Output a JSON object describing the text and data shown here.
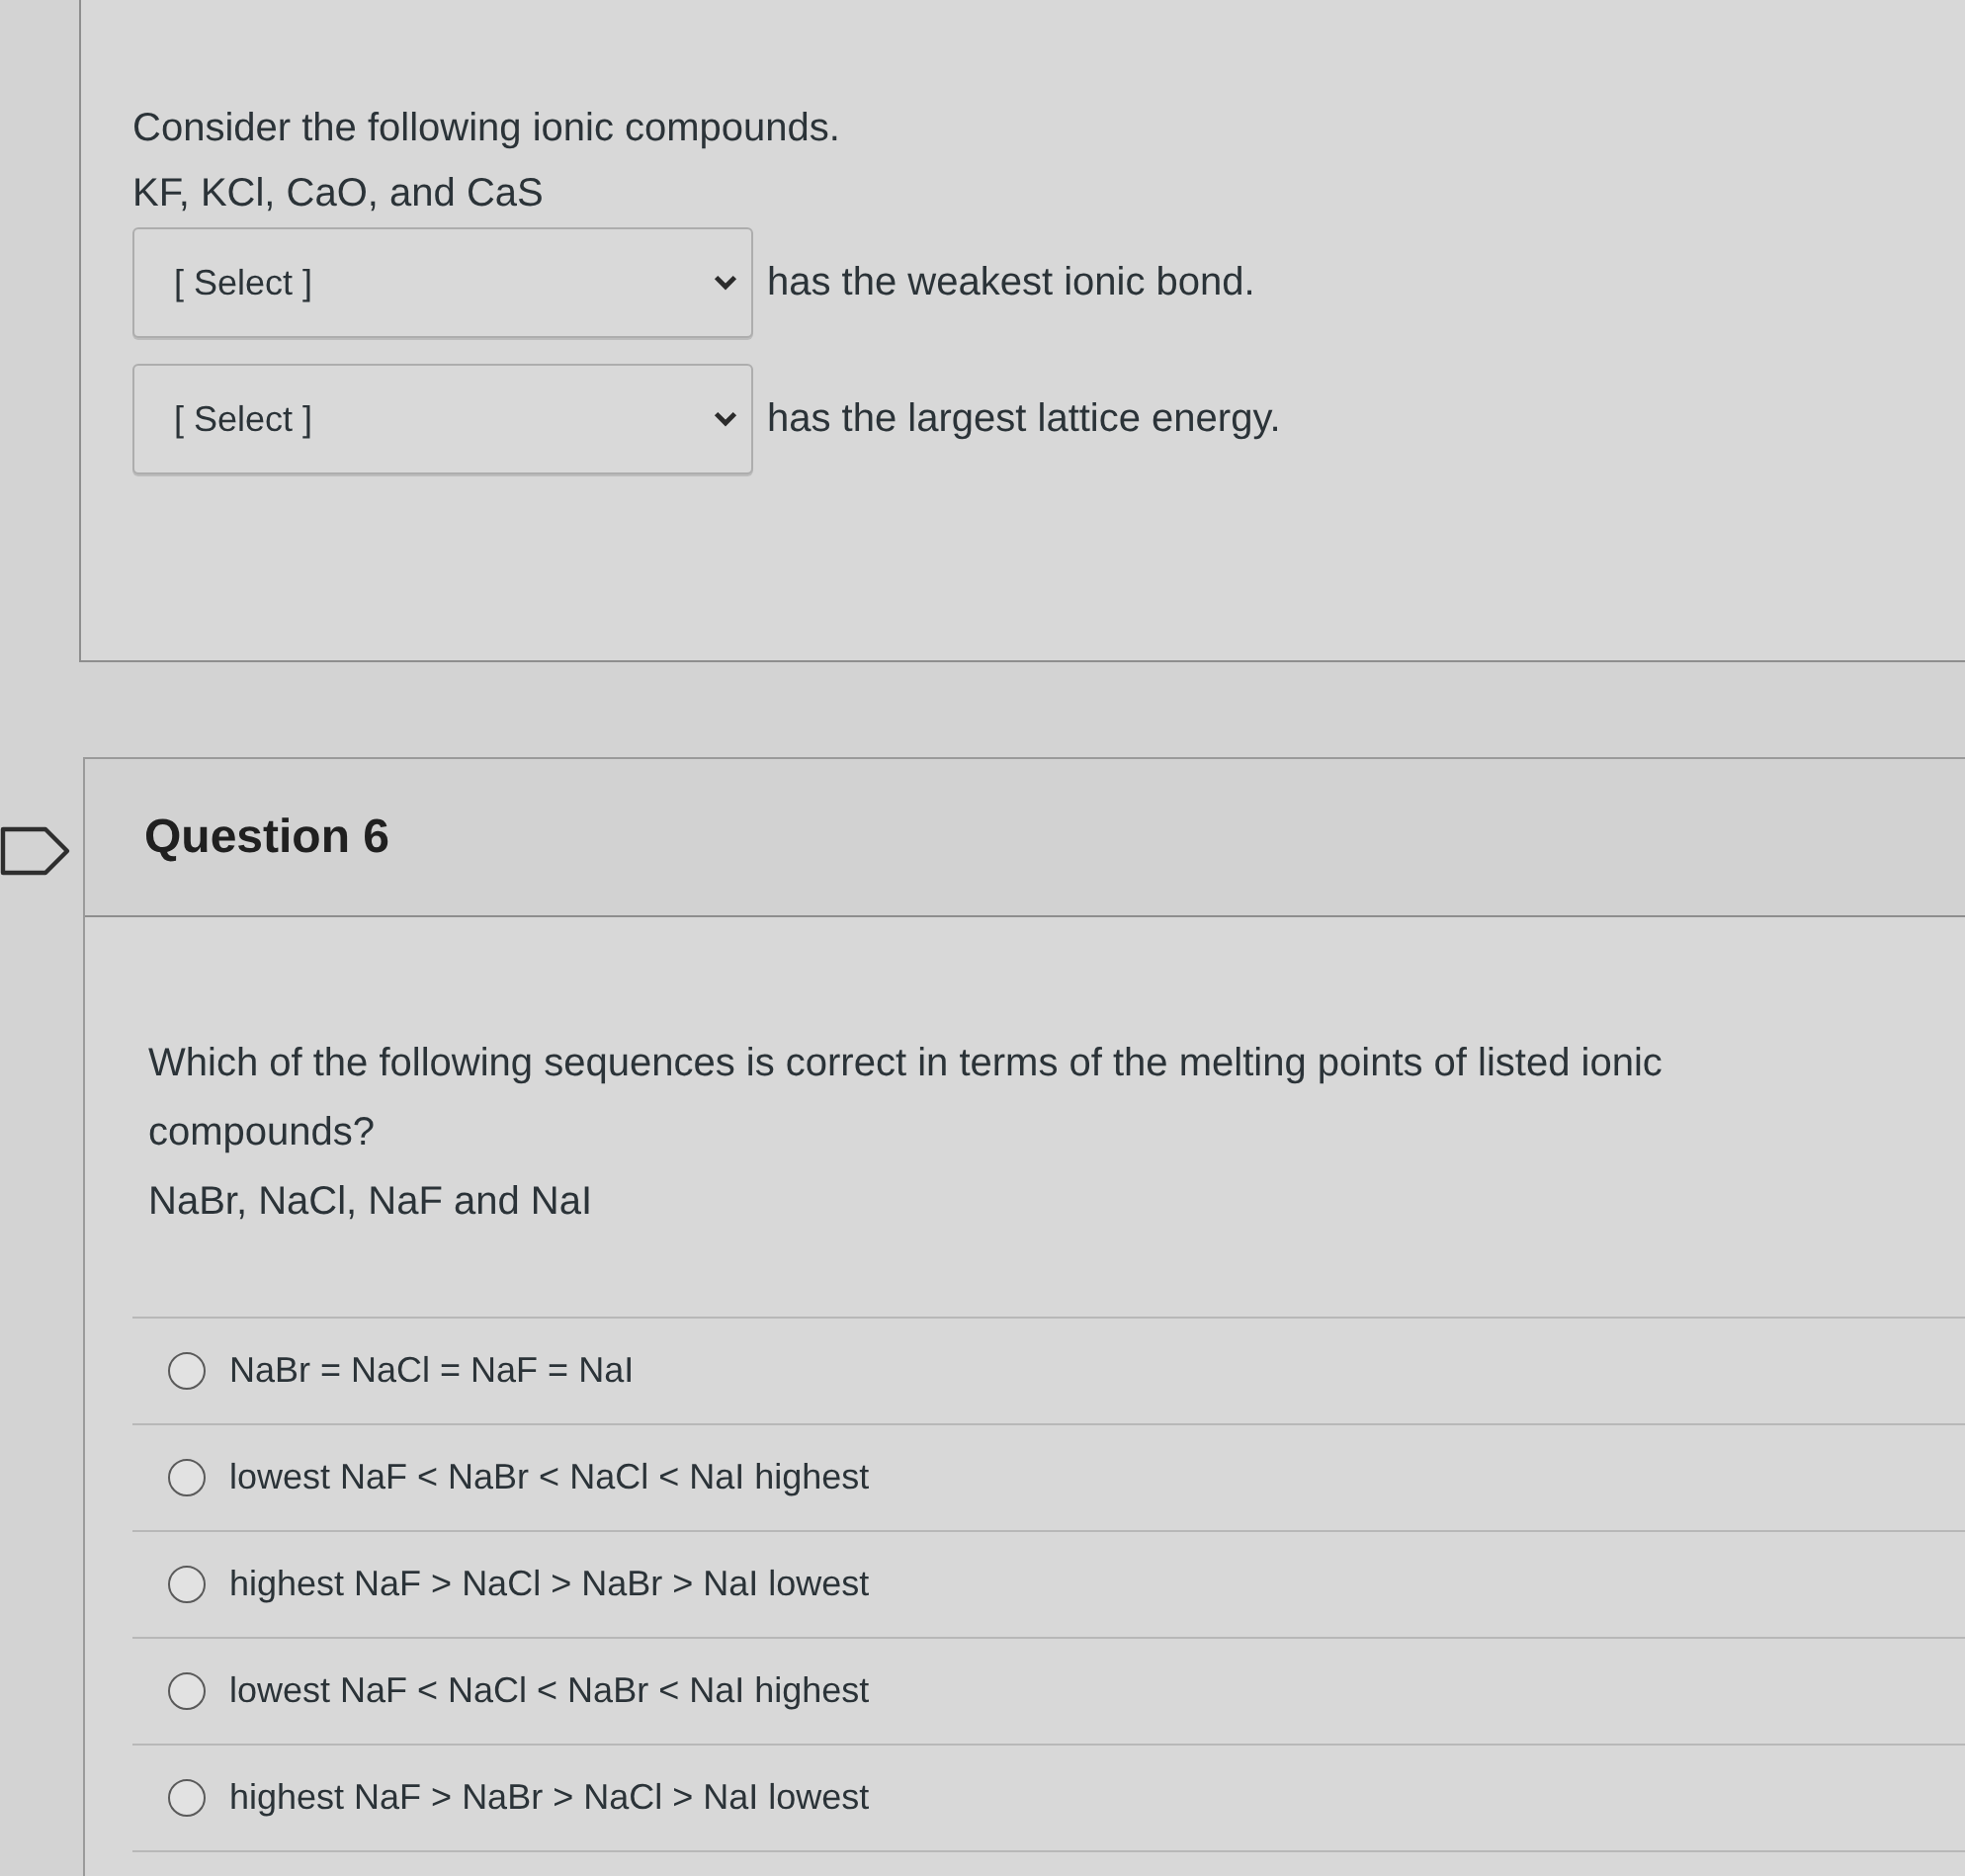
{
  "previous_question": {
    "prompt": "Consider the following ionic compounds.",
    "compounds": "KF, KCl, CaO, and CaS",
    "blanks": [
      {
        "dropdown": {
          "value": "[ Select ]"
        },
        "sentence": "has the weakest ionic bond."
      },
      {
        "dropdown": {
          "value": "[ Select ]"
        },
        "sentence": "has the largest lattice energy."
      }
    ]
  },
  "question": {
    "title": "Question 6",
    "prompt": "Which of the following sequences is correct in terms of the melting points of listed ionic compounds?",
    "compounds": "NaBr, NaCl, NaF and NaI",
    "options": [
      {
        "label": "NaBr = NaCl = NaF = NaI",
        "selected": false
      },
      {
        "label": "lowest NaF < NaBr < NaCl < NaI highest",
        "selected": false
      },
      {
        "label": "highest NaF > NaCl > NaBr > NaI lowest",
        "selected": false
      },
      {
        "label": "lowest NaF < NaCl < NaBr < NaI highest",
        "selected": false
      },
      {
        "label": "highest NaF > NaBr > NaCl > NaI lowest",
        "selected": false
      }
    ]
  }
}
